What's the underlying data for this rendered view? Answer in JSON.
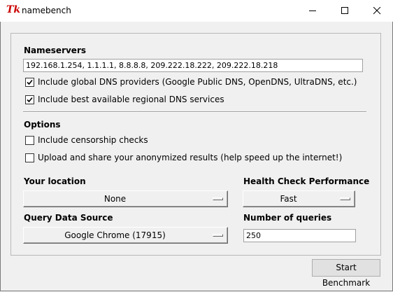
{
  "window": {
    "app_icon": "Tk",
    "title": "namebench"
  },
  "nameservers": {
    "heading": "Nameservers",
    "value": "192.168.1.254, 1.1.1.1, 8.8.8.8, 209.222.18.222, 209.222.18.218",
    "include_global_label": "Include global DNS providers (Google Public DNS, OpenDNS, UltraDNS, etc.)",
    "include_global_checked": true,
    "include_regional_label": "Include best available regional DNS services",
    "include_regional_checked": true
  },
  "options": {
    "heading": "Options",
    "censorship_label": "Include censorship checks",
    "censorship_checked": false,
    "upload_label": "Upload and share your anonymized results (help speed up the internet!)",
    "upload_checked": false
  },
  "location": {
    "label": "Your location",
    "selected": "None"
  },
  "health": {
    "label": "Health Check Performance",
    "selected": "Fast"
  },
  "query_source": {
    "label": "Query Data Source",
    "selected": "Google Chrome (17915)"
  },
  "queries": {
    "label": "Number of queries",
    "value": "250"
  },
  "actions": {
    "start_label": "Start Benchmark"
  }
}
